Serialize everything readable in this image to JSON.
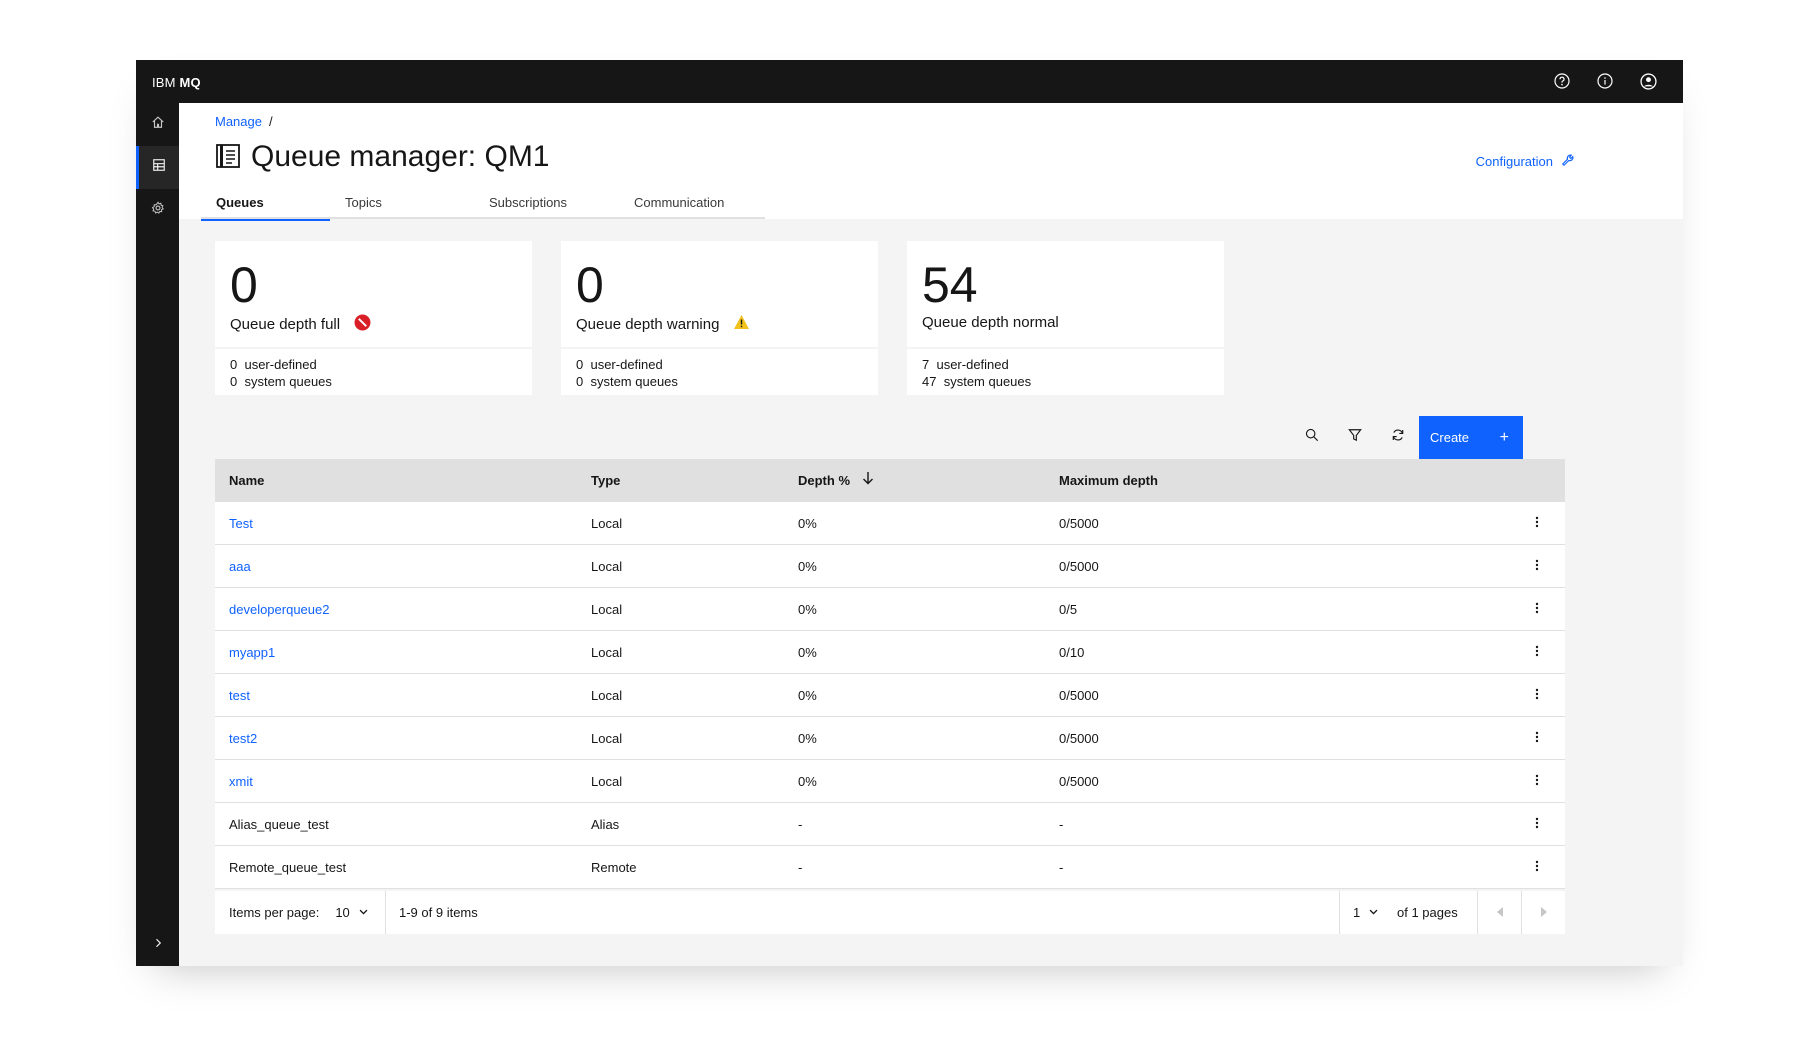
{
  "app": {
    "brand_prefix": "IBM",
    "brand_product": "MQ"
  },
  "topbar_icons": [
    "help-icon",
    "info-icon",
    "user-avatar-icon"
  ],
  "sidenav": {
    "items": [
      "home-icon",
      "grid-icon",
      "settings-icon"
    ],
    "active": 1,
    "expand_icon": "chevron-right-icon"
  },
  "breadcrumb": {
    "link": "Manage",
    "separator": "/"
  },
  "page": {
    "title": "Queue manager: QM1",
    "config_link": "Configuration"
  },
  "tabs": [
    {
      "label": "Queues",
      "active": true
    },
    {
      "label": "Topics",
      "active": false
    },
    {
      "label": "Subscriptions",
      "active": false
    },
    {
      "label": "Communication",
      "active": false
    }
  ],
  "cards": [
    {
      "value": "0",
      "label": "Queue depth full",
      "status_icon": "error-icon",
      "user_count": "0",
      "user_label": "user-defined",
      "system_count": "0",
      "system_label": "system queues"
    },
    {
      "value": "0",
      "label": "Queue depth warning",
      "status_icon": "warning-icon",
      "user_count": "0",
      "user_label": "user-defined",
      "system_count": "0",
      "system_label": "system queues"
    },
    {
      "value": "54",
      "label": "Queue depth normal",
      "status_icon": "",
      "user_count": "7",
      "user_label": "user-defined",
      "system_count": "47",
      "system_label": "system queues"
    }
  ],
  "toolbar": {
    "create_label": "Create",
    "create_icon": "+"
  },
  "table": {
    "headers": {
      "name": "Name",
      "type": "Type",
      "depth": "Depth %",
      "max": "Maximum depth"
    },
    "rows": [
      {
        "name": "Test",
        "type": "Local",
        "depth": "0%",
        "max": "0/5000",
        "is_link": true
      },
      {
        "name": "aaa",
        "type": "Local",
        "depth": "0%",
        "max": "0/5000",
        "is_link": true
      },
      {
        "name": "developerqueue2",
        "type": "Local",
        "depth": "0%",
        "max": "0/5",
        "is_link": true
      },
      {
        "name": "myapp1",
        "type": "Local",
        "depth": "0%",
        "max": "0/10",
        "is_link": true
      },
      {
        "name": "test",
        "type": "Local",
        "depth": "0%",
        "max": "0/5000",
        "is_link": true
      },
      {
        "name": "test2",
        "type": "Local",
        "depth": "0%",
        "max": "0/5000",
        "is_link": true
      },
      {
        "name": "xmit",
        "type": "Local",
        "depth": "0%",
        "max": "0/5000",
        "is_link": true
      },
      {
        "name": "Alias_queue_test",
        "type": "Alias",
        "depth": "-",
        "max": "-",
        "is_link": false
      },
      {
        "name": "Remote_queue_test",
        "type": "Remote",
        "depth": "-",
        "max": "-",
        "is_link": false
      }
    ]
  },
  "pagination": {
    "items_per_page_label": "Items per page:",
    "items_per_page": "10",
    "range": "1-9 of 9 items",
    "page": "1",
    "pages_label": "of 1 pages"
  },
  "colors": {
    "accent": "#0f62fe",
    "error": "#da1e28",
    "warning": "#f1c21b",
    "shell": "#161616"
  }
}
